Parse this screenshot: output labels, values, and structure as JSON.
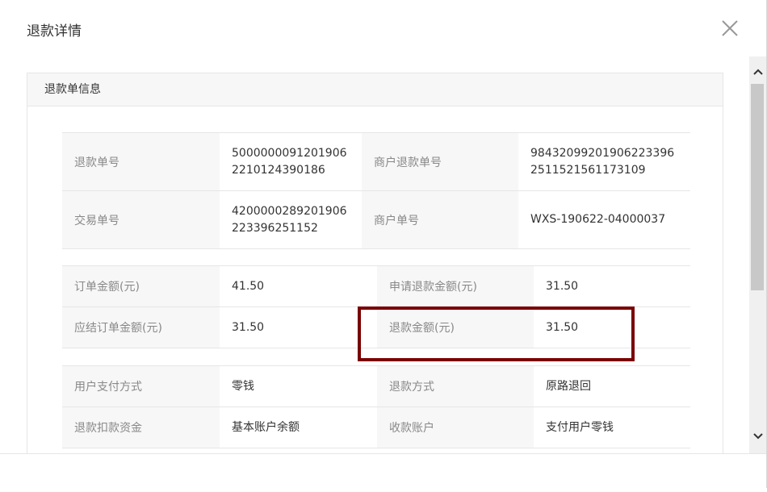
{
  "dialog": {
    "title": "退款详情",
    "section_title": "退款单信息"
  },
  "ids": [
    {
      "label1": "退款单号",
      "value1": "5000000091201906\n2210124390186",
      "label2": "商户退款单号",
      "value2": "98432099201906223396\n2511521561173109"
    },
    {
      "label1": "交易单号",
      "value1": "4200000289201906\n223396251152",
      "label2": "商户单号",
      "value2": "WXS-190622-04000037"
    }
  ],
  "amounts": [
    {
      "label1": "订单金额(元)",
      "value1": "41.50",
      "label2": "申请退款金额(元)",
      "value2": "31.50"
    },
    {
      "label1": "应结订单金额(元)",
      "value1": "31.50",
      "label2": "退款金额(元)",
      "value2": "31.50"
    }
  ],
  "payment": [
    {
      "label1": "用户支付方式",
      "value1": "零钱",
      "label2": "退款方式",
      "value2": "原路退回"
    },
    {
      "label1": "退款扣款资金",
      "value1": "基本账户余额",
      "label2": "收款账户",
      "value2": "支付用户零钱"
    }
  ],
  "icons": {
    "close": "close-icon",
    "scroll_up": "chevron-up-icon",
    "scroll_down": "chevron-down-icon"
  },
  "colors": {
    "highlight_border": "#7a0000",
    "label_bg": "#f7f7f7"
  }
}
